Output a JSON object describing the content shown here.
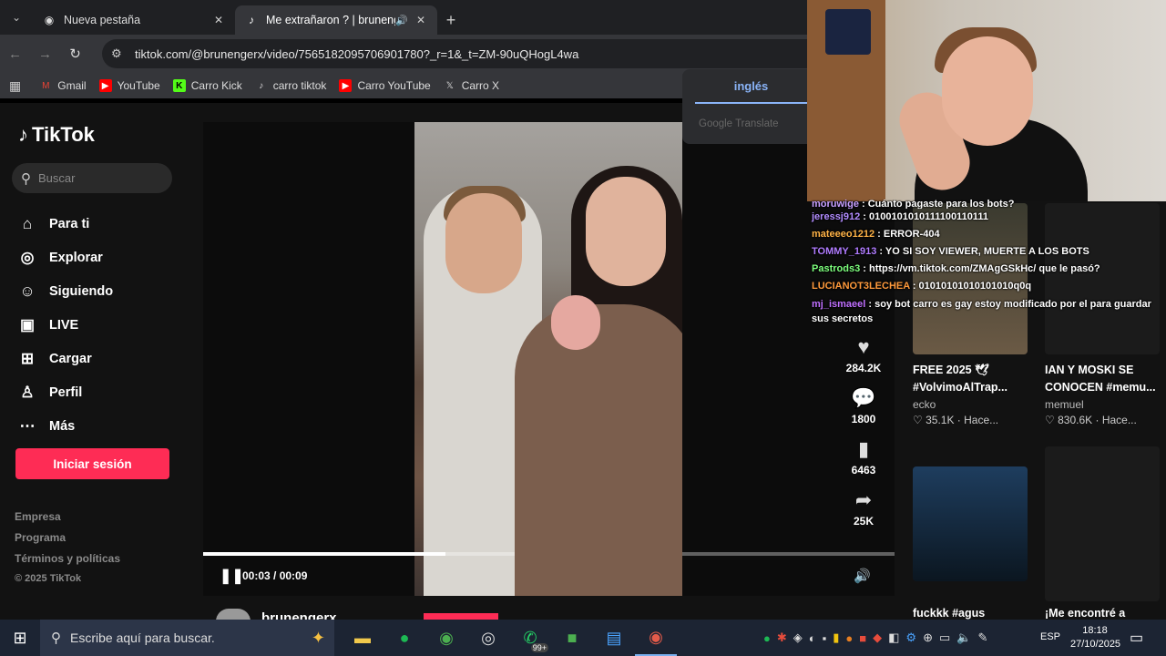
{
  "browser": {
    "tabs": [
      {
        "title": "Nueva pestaña",
        "icon": "chrome-icon",
        "active": false
      },
      {
        "title": "Me extrañaron ? | brunenge",
        "icon": "tiktok-icon",
        "active": true
      }
    ],
    "url": "tiktok.com/@brunengerx/video/7565182095706901780?_r=1&_t=ZM-90uQHogL4wa",
    "bookmarks": [
      {
        "label": "Gmail",
        "icon": "gmail-icon"
      },
      {
        "label": "YouTube",
        "icon": "youtube-icon"
      },
      {
        "label": "Carro Kick",
        "icon": "kick-icon"
      },
      {
        "label": "carro tiktok",
        "icon": "tiktok-icon"
      },
      {
        "label": "Carro YouTube",
        "icon": "youtube-icon"
      },
      {
        "label": "Carro X",
        "icon": "x-icon"
      }
    ]
  },
  "translate": {
    "language": "inglés",
    "provider": "Google Translate"
  },
  "tiktok": {
    "logo": "TikTok",
    "search_placeholder": "Buscar",
    "nav": [
      {
        "label": "Para ti",
        "icon": "home-icon"
      },
      {
        "label": "Explorar",
        "icon": "compass-icon"
      },
      {
        "label": "Siguiendo",
        "icon": "following-icon"
      },
      {
        "label": "LIVE",
        "icon": "live-icon"
      },
      {
        "label": "Cargar",
        "icon": "upload-icon"
      },
      {
        "label": "Perfil",
        "icon": "profile-icon"
      },
      {
        "label": "Más",
        "icon": "more-icon"
      }
    ],
    "login": "Iniciar sesión",
    "footer": [
      "Empresa",
      "Programa",
      "Términos y políticas",
      "© 2025 TikTok"
    ],
    "player": {
      "time": "00:03 / 00:09",
      "progress": 0.35
    },
    "author": "brunengerx",
    "actions": [
      {
        "name": "like",
        "icon": "heart-icon",
        "count": "284.2K"
      },
      {
        "name": "comment",
        "icon": "comment-icon",
        "count": "1800"
      },
      {
        "name": "save",
        "icon": "bookmark-icon",
        "count": "6463"
      },
      {
        "name": "share",
        "icon": "share-icon",
        "count": "25K"
      }
    ],
    "related": [
      {
        "title": "FREE 2025 🕊 #VolvimoAlTrap...",
        "author": "ecko",
        "likes": "35.1K",
        "time": "Hace..."
      },
      {
        "title": "IAN Y MOSKI SE CONOCEN #memu...",
        "author": "memuel",
        "likes": "830.6K",
        "time": "Hace..."
      },
      {
        "title": "fuckkk #agus",
        "author": "",
        "likes": "",
        "time": ""
      },
      {
        "title": "¡Me encontré a",
        "author": "",
        "likes": "",
        "time": ""
      }
    ]
  },
  "chat": [
    {
      "user": "moruwige",
      "text": "Cuánto pagaste para los bots?",
      "color": "#c8a0ff"
    },
    {
      "user": "jeressj912",
      "text": "0100101010111100110111",
      "color": "#b28cff"
    },
    {
      "user": "mateeeo1212",
      "text": "ERROR-404",
      "color": "#ffb347"
    },
    {
      "user": "TOMMY_1913",
      "text": "YO SI SOY VIEWER, MUERTE A LOS BOTS",
      "color": "#b07cff"
    },
    {
      "user": "Pastrods3",
      "text": "https://vm.tiktok.com/ZMAgGSkHc/ que le pasó?",
      "color": "#7dff7d"
    },
    {
      "user": "LUCIANOT3LECHEA",
      "text": "01010101010101010q0q",
      "color": "#ff9a3c"
    },
    {
      "user": "mj_ismaeel",
      "text": "soy bot carro es gay estoy modificado por el para guardar sus secretos",
      "color": "#c070ff"
    }
  ],
  "taskbar": {
    "search_placeholder": "Escribe aquí para buscar.",
    "whatsapp_badge": "99+",
    "language": "ESP",
    "time": "18:18",
    "date": "27/10/2025"
  }
}
